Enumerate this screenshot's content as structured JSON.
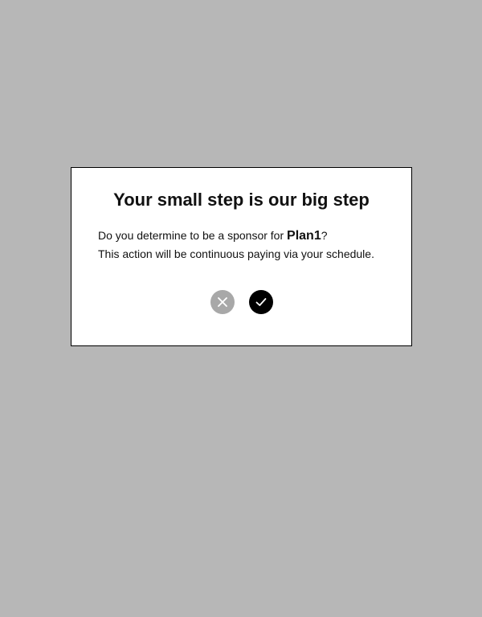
{
  "dialog": {
    "title": "Your small step is our big step",
    "message_prefix": "Do you determine to be a sponsor for ",
    "plan_name": "Plan1",
    "message_suffix": "?",
    "message_line2": "This action will be continuous paying via your schedule.",
    "cancel_icon": "close-icon",
    "confirm_icon": "check-icon"
  },
  "colors": {
    "backdrop": "#b7b7b7",
    "dialog_bg": "#ffffff",
    "cancel_button": "#a8a8a8",
    "confirm_button": "#000000"
  }
}
